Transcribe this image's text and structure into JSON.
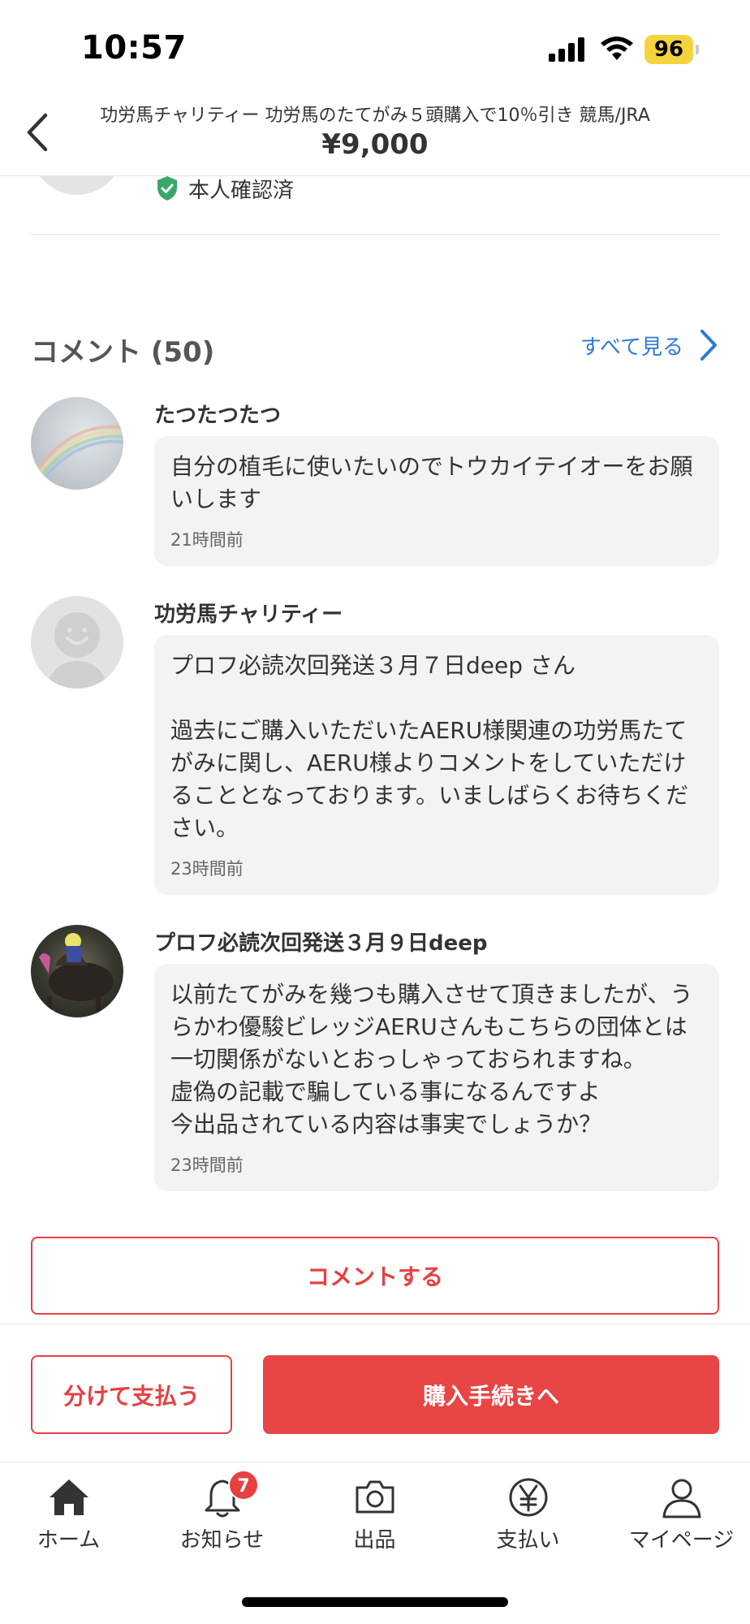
{
  "status_bar": {
    "time": "10:57",
    "battery": "96",
    "icons": [
      "signal-icon",
      "wifi-icon",
      "battery-icon"
    ]
  },
  "header": {
    "title": "功労馬チャリティー 功労馬のたてがみ５頭購入で10％引き 競馬/JRA",
    "price": "¥9,000",
    "back_icon": "chevron-left-icon"
  },
  "seller": {
    "verified_label": "本人確認済",
    "verified_icon": "shield-check-icon"
  },
  "comments": {
    "heading": "コメント (50)",
    "see_all": "すべて見る",
    "items": [
      {
        "name": "たつたつたつ",
        "text": "自分の植毛に使いたいのでトウカイテイオーをお願いします",
        "time": "21時間前"
      },
      {
        "name": "功労馬チャリティー",
        "text": "プロフ必読次回発送３月７日deep さん\n\n過去にご購入いただいたAERU様関連の功労馬たてがみに関し、AERU様よりコメントをしていただけることとなっております。いましばらくお待ちください。",
        "time": "23時間前"
      },
      {
        "name": "プロフ必読次回発送３月９日deep",
        "text": "以前たてがみを幾つも購入させて頂きましたが、うらかわ優駿ビレッジAERUさんもこちらの団体とは一切関係がないとおっしゃっておられますね。\n虚偽の記載で騙している事になるんですよ\n今出品されている内容は事実でしょうか？",
        "time": "23時間前"
      }
    ]
  },
  "actions": {
    "comment_button": "コメントする",
    "split_pay_button": "分けて支払う",
    "purchase_button": "購入手続きへ"
  },
  "tab_bar": {
    "tabs": [
      {
        "label": "ホーム",
        "icon": "home-icon"
      },
      {
        "label": "お知らせ",
        "icon": "bell-icon",
        "badge": "7"
      },
      {
        "label": "出品",
        "icon": "camera-icon"
      },
      {
        "label": "支払い",
        "icon": "yen-icon"
      },
      {
        "label": "マイページ",
        "icon": "person-icon"
      }
    ]
  },
  "colors": {
    "accent": "#e84040",
    "link": "#2f7ad8",
    "battery": "#f5d33f",
    "verified": "#3aa66a"
  }
}
